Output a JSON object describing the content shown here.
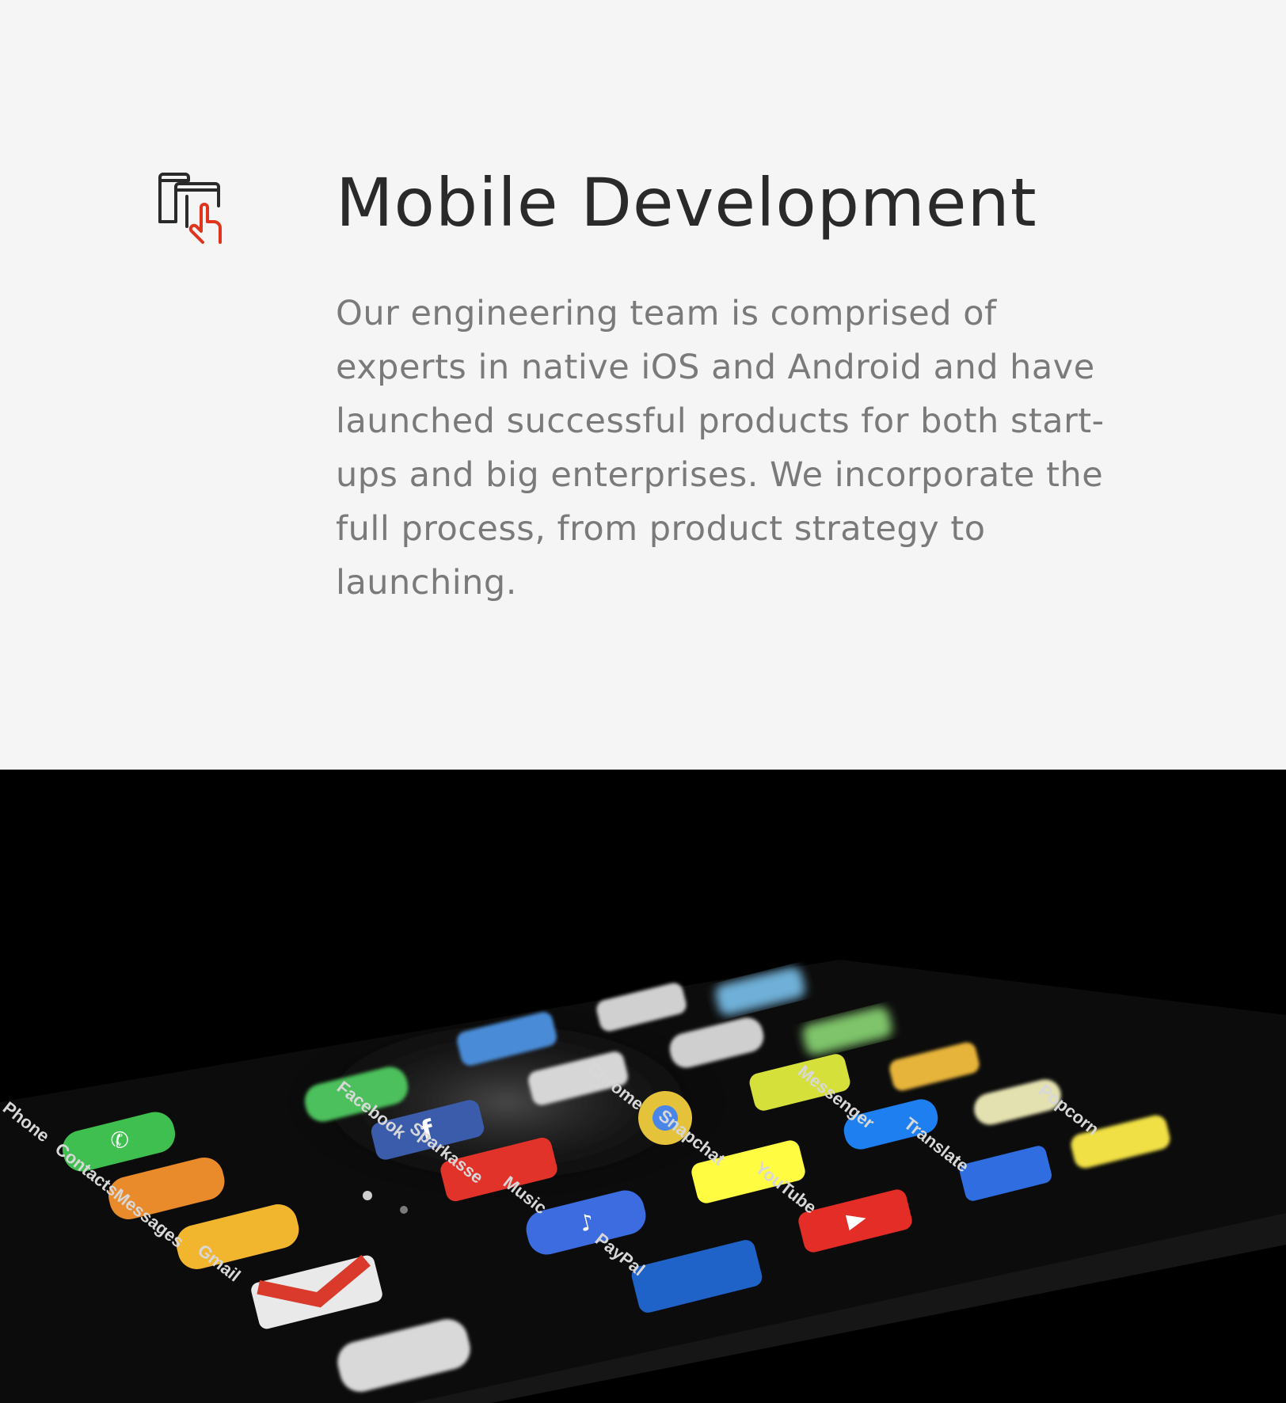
{
  "service": {
    "title": "Mobile Development",
    "description": "Our engineering team is comprised of experts in native iOS and Android and have launched successful products for both start-ups and big enterprises. We incorporate the full process, from product strategy to launching.",
    "icon": "mobile-touch-icon",
    "accent_color": "#e0341c",
    "text_color": "#2a2a2a",
    "body_color": "#7a7a7a"
  },
  "hero_image": {
    "description_icon": "smartphone-app-grid-photo",
    "app_labels": [
      "Phone",
      "Contacts",
      "Messages",
      "Gmail",
      "Facebook",
      "Sparkasse",
      "Music",
      "PayPal",
      "Chrome",
      "Snapchat",
      "YouTube",
      "Messenger",
      "Translate",
      "Popcorn"
    ]
  }
}
